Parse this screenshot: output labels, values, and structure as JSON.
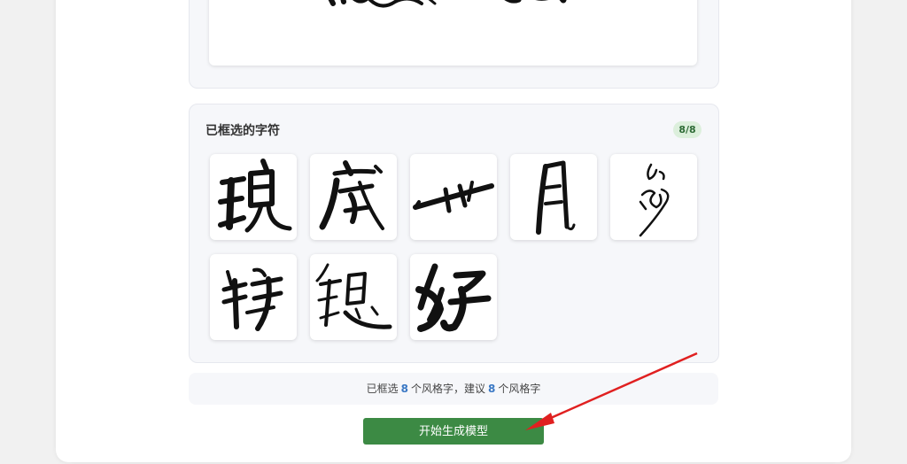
{
  "selected_panel": {
    "title": "已框选的字符",
    "count_badge": "8/8",
    "characters": [
      {
        "name": "char-1",
        "glyph": "tile-char-1"
      },
      {
        "name": "char-2",
        "glyph": "tile-char-2"
      },
      {
        "name": "char-3",
        "glyph": "tile-char-3"
      },
      {
        "name": "char-4",
        "glyph": "tile-char-4"
      },
      {
        "name": "char-5",
        "glyph": "tile-char-5"
      },
      {
        "name": "char-6",
        "glyph": "tile-char-6"
      },
      {
        "name": "char-7",
        "glyph": "tile-char-7"
      },
      {
        "name": "char-8",
        "glyph": "tile-char-8"
      }
    ]
  },
  "summary": {
    "prefix": "已框选",
    "selected_count": "8",
    "middle": "个风格字，建议",
    "suggested_count": "8",
    "suffix": "个风格字"
  },
  "actions": {
    "start_button_label": "开始生成模型"
  },
  "colors": {
    "accent_green": "#3c8a44",
    "badge_green": "#dcefdc",
    "count_blue": "#3a78c4",
    "arrow_red": "#e02020"
  }
}
